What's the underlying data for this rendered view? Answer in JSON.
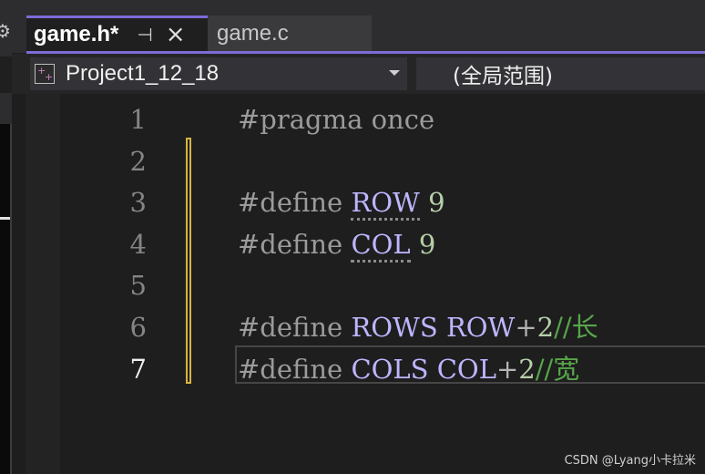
{
  "tabs": [
    {
      "title": "game.h*",
      "active": true,
      "pin_icon": "pin-icon",
      "close_icon": "close-icon"
    },
    {
      "title": "game.c",
      "active": false
    }
  ],
  "navbar": {
    "project": "Project1_12_18",
    "scope": "(全局范围)"
  },
  "editor": {
    "line_numbers": [
      "1",
      "2",
      "3",
      "4",
      "5",
      "6",
      "7"
    ],
    "current_line": 7,
    "lines": [
      {
        "tokens": [
          {
            "t": "#pragma once",
            "k": "kw"
          }
        ]
      },
      {
        "tokens": []
      },
      {
        "tokens": [
          {
            "t": "#define ",
            "k": "kw"
          },
          {
            "t": "ROW",
            "k": "mac",
            "u": true
          },
          {
            "t": " 9",
            "k": "num"
          }
        ]
      },
      {
        "tokens": [
          {
            "t": "#define ",
            "k": "kw"
          },
          {
            "t": "COL",
            "k": "mac",
            "u": true
          },
          {
            "t": " 9",
            "k": "num"
          }
        ]
      },
      {
        "tokens": []
      },
      {
        "tokens": [
          {
            "t": "#define ",
            "k": "kw"
          },
          {
            "t": "ROWS ROW",
            "k": "mac"
          },
          {
            "t": "+",
            "k": "op"
          },
          {
            "t": "2",
            "k": "num"
          },
          {
            "t": "//长",
            "k": "cmt"
          }
        ]
      },
      {
        "tokens": [
          {
            "t": "#define ",
            "k": "kw"
          },
          {
            "t": "COLS COL",
            "k": "mac"
          },
          {
            "t": "+",
            "k": "op"
          },
          {
            "t": "2",
            "k": "num"
          },
          {
            "t": "//宽",
            "k": "cmt"
          }
        ]
      }
    ]
  },
  "watermark": "CSDN @Lyang小卡拉米",
  "colors": {
    "accent": "#7d6bd8",
    "change_marker": "#d6b541",
    "macro": "#bdb6ff",
    "comment": "#57a64a",
    "number": "#b5cea8"
  }
}
